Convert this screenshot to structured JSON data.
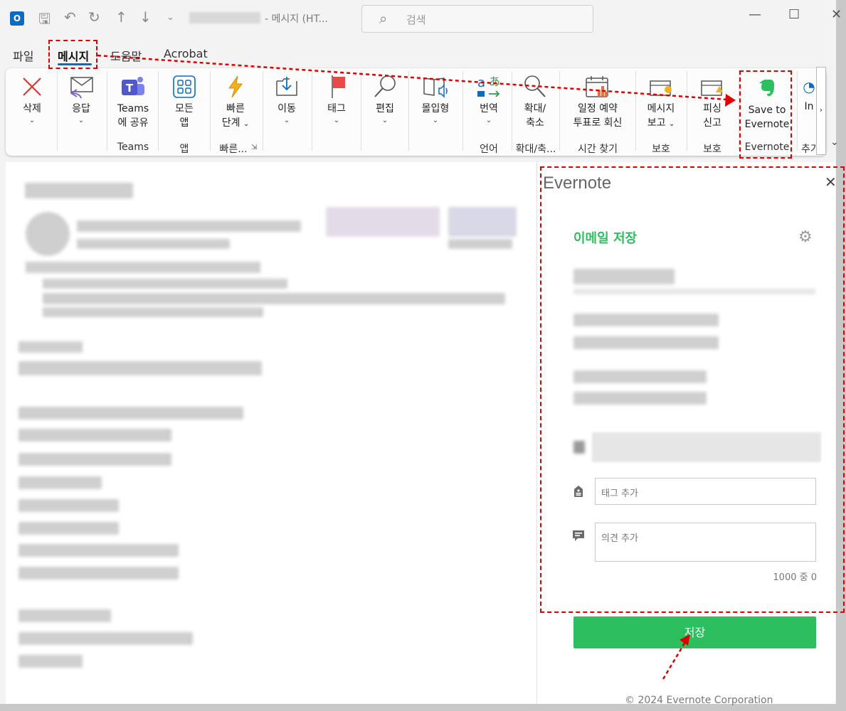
{
  "titlebar": {
    "window_title": "-  메시지 (HT...",
    "search_placeholder": "검색",
    "app_icon_letter": "O"
  },
  "menu": {
    "tabs": [
      "파일",
      "메시지",
      "도움말",
      "Acrobat"
    ]
  },
  "ribbon": {
    "buttons": {
      "delete": "삭제",
      "reply": "응답",
      "teams_share_1": "Teams",
      "teams_share_2": "에 공유",
      "all_apps_1": "모든",
      "all_apps_2": "앱",
      "quick_1": "빠른",
      "quick_2": "단계",
      "move": "이동",
      "tag": "태그",
      "edit": "편집",
      "immersive": "몰입형",
      "translate": "번역",
      "zoom_1": "확대/",
      "zoom_2": "축소",
      "schedule_1": "일정 예약",
      "schedule_2": "투표로 회신",
      "report_1": "메시지",
      "report_2": "보고",
      "phish_1": "피싱",
      "phish_2": "신고",
      "evernote_1": "Save to",
      "evernote_2": "Evernote",
      "insights_partial": "In"
    },
    "groups": {
      "teams": "Teams",
      "apps": "앱",
      "quick": "빠른...",
      "language": "언어",
      "zoom": "확대/축...",
      "time": "시간 찾기",
      "protect1": "보호",
      "protect2": "보호",
      "evernote": "Evernote",
      "addins": "추가"
    }
  },
  "evernote": {
    "title": "Evernote",
    "heading": "이메일 저장",
    "tag_placeholder": "태그 추가",
    "comment_placeholder": "의견 추가",
    "counter": "1000 중 0",
    "save_label": "저장",
    "copyright": "© 2024 Evernote Corporation"
  },
  "colors": {
    "accent": "#0f6cbd",
    "evernote_green": "#2dbe60",
    "annotation_red": "#e00000"
  }
}
